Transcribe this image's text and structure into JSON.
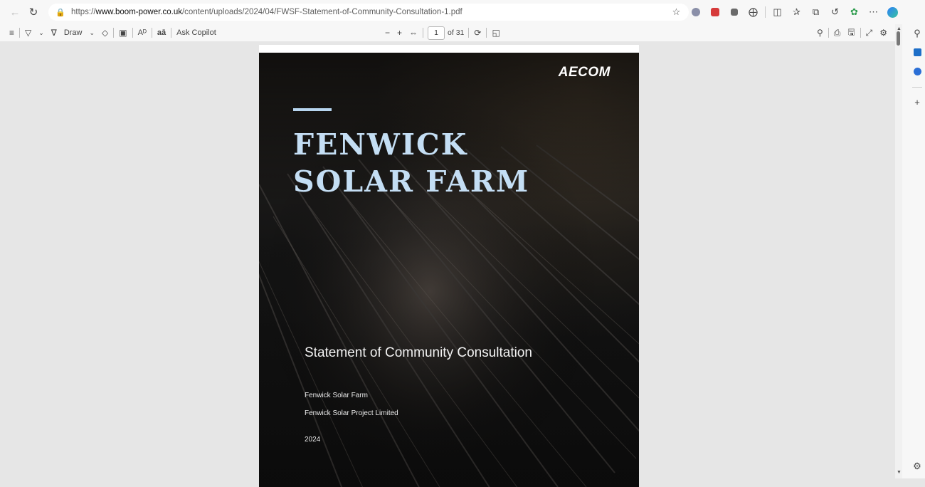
{
  "browser": {
    "url_prefix": "https://",
    "url_domain": "www.boom-power.co.uk",
    "url_path": "/content/uploads/2024/04/FWSF-Statement-of-Community-Consultation-1.pdf"
  },
  "pdf_toolbar": {
    "draw_label": "Draw",
    "ask_copilot_label": "Ask Copilot",
    "page_number": "1",
    "page_total": "of 31",
    "zoom_out": "−",
    "zoom_in": "+"
  },
  "cover": {
    "logo": "AECOM",
    "title_line1": "FENWICK",
    "title_line2": "SOLAR FARM",
    "subtitle": "Statement of Community Consultation",
    "project": "Fenwick Solar Farm",
    "company": "Fenwick Solar Project Limited",
    "year": "2024"
  },
  "colors": {
    "title": "#c4def4",
    "accent": "#b7d5ef",
    "cover_bg": "#141414"
  }
}
